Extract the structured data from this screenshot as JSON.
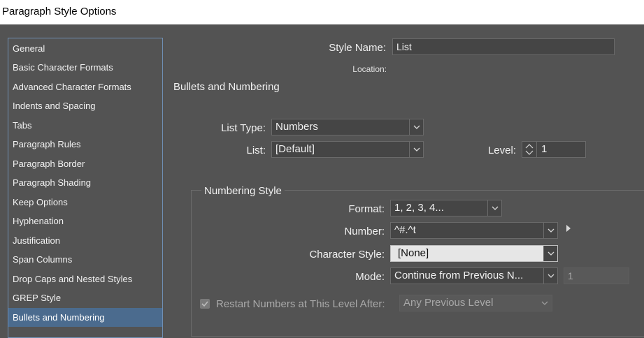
{
  "window": {
    "title": "Paragraph Style Options"
  },
  "sidebar": {
    "items": [
      {
        "label": "General"
      },
      {
        "label": "Basic Character Formats"
      },
      {
        "label": "Advanced Character Formats"
      },
      {
        "label": "Indents and Spacing"
      },
      {
        "label": "Tabs"
      },
      {
        "label": "Paragraph Rules"
      },
      {
        "label": "Paragraph Border"
      },
      {
        "label": "Paragraph Shading"
      },
      {
        "label": "Keep Options"
      },
      {
        "label": "Hyphenation"
      },
      {
        "label": "Justification"
      },
      {
        "label": "Span Columns"
      },
      {
        "label": "Drop Caps and Nested Styles"
      },
      {
        "label": "GREP Style"
      },
      {
        "label": "Bullets and Numbering",
        "selected": true
      }
    ]
  },
  "style_name": {
    "label": "Style Name:",
    "value": "List"
  },
  "location": {
    "label": "Location:"
  },
  "section_title": "Bullets and Numbering",
  "list_type": {
    "label": "List Type:",
    "value": "Numbers"
  },
  "list": {
    "label": "List:",
    "value": "[Default]"
  },
  "level": {
    "label": "Level:",
    "value": "1"
  },
  "numbering_style": {
    "title": "Numbering Style",
    "format": {
      "label": "Format:",
      "value": "1, 2, 3, 4..."
    },
    "number": {
      "label": "Number:",
      "value": "^#.^t"
    },
    "character_style": {
      "label": "Character Style:",
      "value": "[None]"
    },
    "mode": {
      "label": "Mode:",
      "value": "Continue from Previous N...",
      "start_value": "1"
    },
    "restart": {
      "label": "Restart Numbers at This Level After:",
      "value": "Any Previous Level",
      "checked": true
    }
  },
  "colors": {
    "background": "#535353",
    "selected": "#4b6b8e",
    "sidebar_border": "#6f8fb3"
  }
}
